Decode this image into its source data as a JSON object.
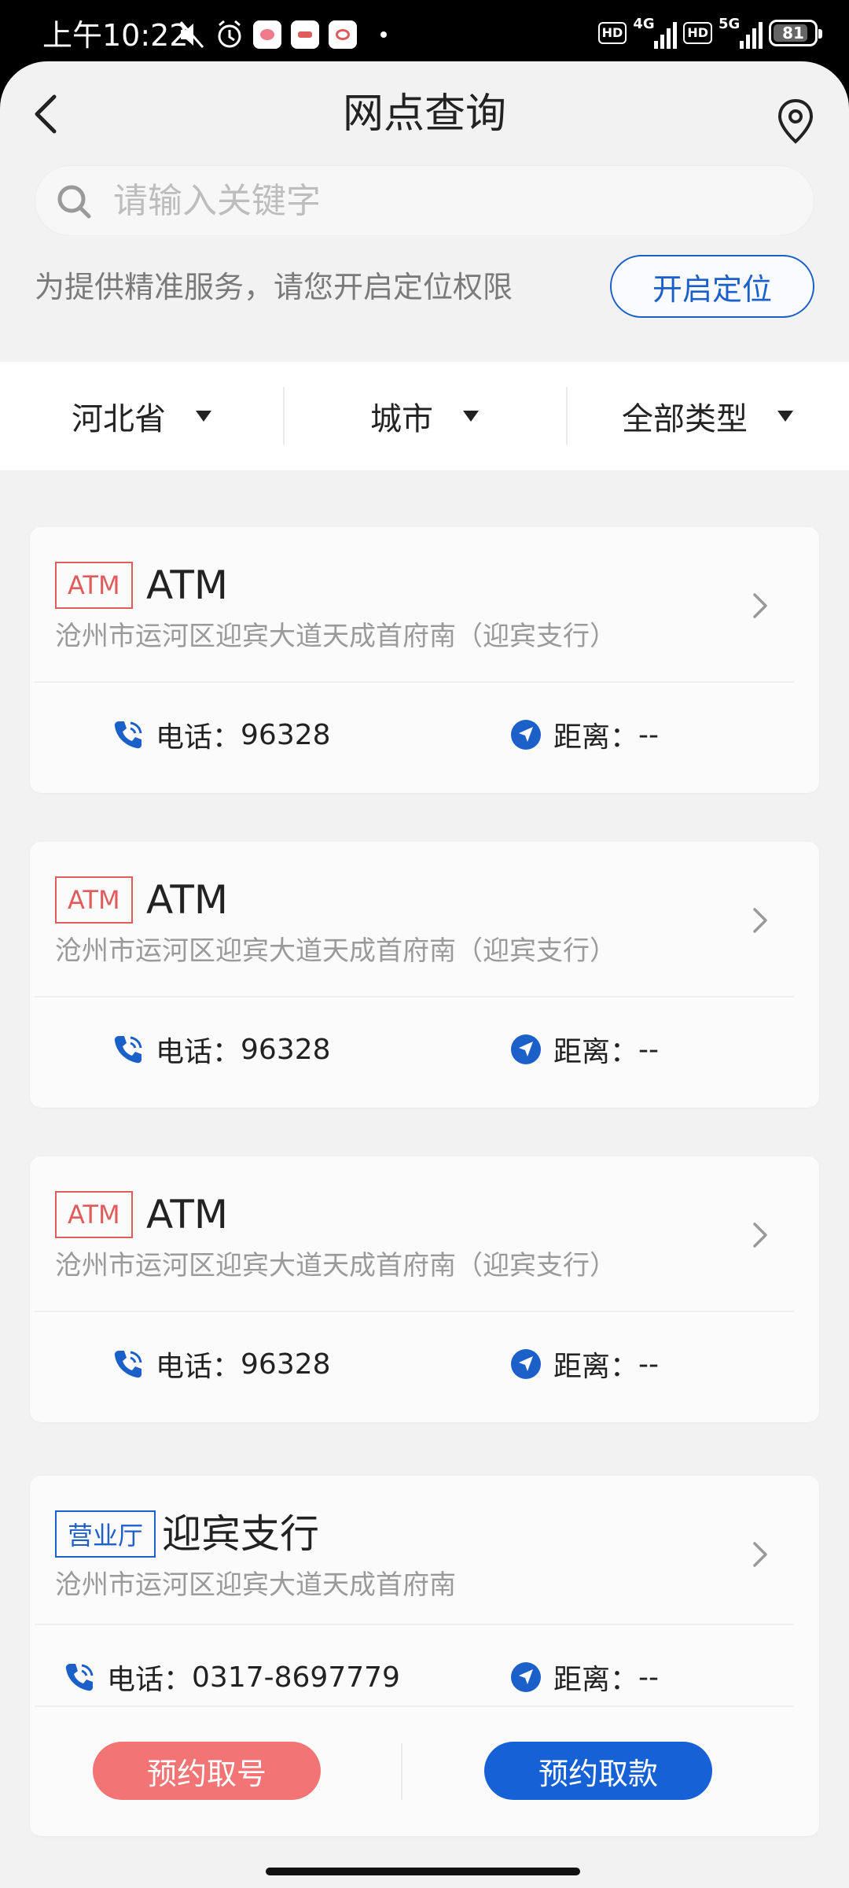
{
  "status_bar": {
    "time": "上午10:22",
    "hd_1": "HD",
    "network_1": "4G",
    "hd_2": "HD",
    "network_2": "5G",
    "battery": "81"
  },
  "nav": {
    "title": "网点查询"
  },
  "search": {
    "placeholder": "请输入关键字",
    "value": ""
  },
  "location": {
    "tip": "为提供精准服务，请您开启定位权限",
    "button_label": "开启定位"
  },
  "filters": [
    {
      "label": "河北省"
    },
    {
      "label": "城市"
    },
    {
      "label": "全部类型"
    }
  ],
  "outlets": [
    {
      "tag": "ATM",
      "name": "ATM",
      "address": "沧州市运河区迎宾大道天成首府南（迎宾支行）",
      "phone_label": "电话：",
      "phone": "96328",
      "distance_label": "距离：",
      "distance": "--"
    },
    {
      "tag": "ATM",
      "name": "ATM",
      "address": "沧州市运河区迎宾大道天成首府南（迎宾支行）",
      "phone_label": "电话：",
      "phone": "96328",
      "distance_label": "距离：",
      "distance": "--"
    },
    {
      "tag": "ATM",
      "name": "ATM",
      "address": "沧州市运河区迎宾大道天成首府南（迎宾支行）",
      "phone_label": "电话：",
      "phone": "96328",
      "distance_label": "距离：",
      "distance": "--"
    },
    {
      "tag": "营业厅",
      "name": "迎宾支行",
      "address": "沧州市运河区迎宾大道天成首府南",
      "phone_label": "电话：",
      "phone": "0317-8697779",
      "distance_label": "距离：",
      "distance": "--",
      "btn_queue": "预约取号",
      "btn_withdraw": "预约取款"
    }
  ],
  "colors": {
    "primary_blue": "#1761d6",
    "atm_red": "#e05c5c",
    "queue_pink": "#f27474"
  }
}
